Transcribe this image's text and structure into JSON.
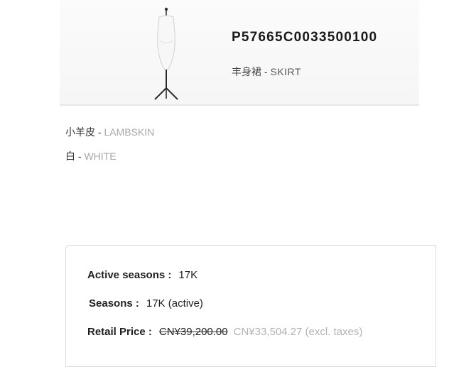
{
  "product": {
    "sku": "P57665C0033500100",
    "category_cn": "丰身裙",
    "category_sep": " - ",
    "category_en": "SKIRT"
  },
  "attributes": {
    "material_cn": "小羊皮",
    "material_sep": " - ",
    "material_en": "LAMBSKIN",
    "color_cn": "白",
    "color_sep": " - ",
    "color_en": "WHITE"
  },
  "details": {
    "active_seasons_label": "Active seasons :",
    "active_seasons_value": "17K",
    "seasons_label": "Seasons :",
    "seasons_value": "17K (active)",
    "retail_price_label": "Retail Price :",
    "retail_price": "CN¥39,200.00",
    "net_price": "CN¥33,504.27 (excl. taxes)"
  }
}
